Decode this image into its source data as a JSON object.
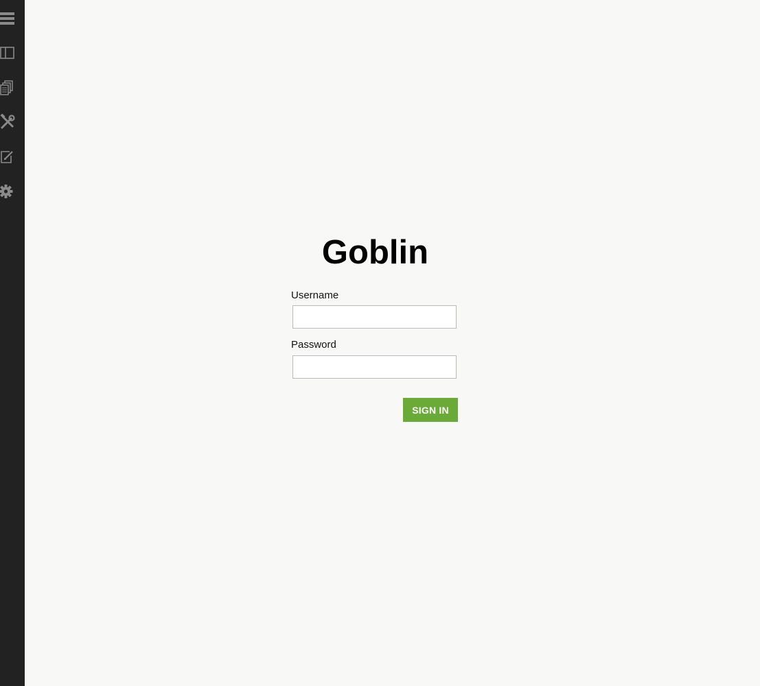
{
  "sidebar": {
    "items": [
      {
        "icon": "menu-icon"
      },
      {
        "icon": "panel-icon"
      },
      {
        "icon": "pages-icon"
      },
      {
        "icon": "tools-icon"
      },
      {
        "icon": "edit-icon"
      },
      {
        "icon": "gear-icon"
      }
    ]
  },
  "login": {
    "title": "Goblin",
    "username_label": "Username",
    "username_value": "",
    "password_label": "Password",
    "password_value": "",
    "signin_label": "SIGN IN"
  },
  "colors": {
    "sidebar_bg": "#222222",
    "icon": "#8a8a8a",
    "page_bg": "#f8f9f6",
    "button_bg": "#6aab37"
  }
}
